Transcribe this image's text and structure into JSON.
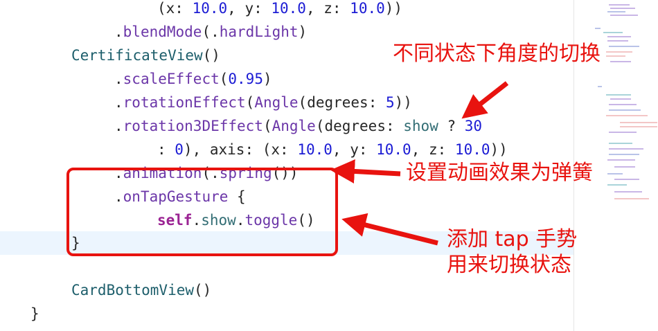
{
  "code": {
    "line1": [
      {
        "t": "(x: ",
        "c": "plain"
      },
      {
        "t": "10.0",
        "c": "num"
      },
      {
        "t": ", y: ",
        "c": "plain"
      },
      {
        "t": "10.0",
        "c": "num"
      },
      {
        "t": ", z: ",
        "c": "plain"
      },
      {
        "t": "10.0",
        "c": "num"
      },
      {
        "t": "))",
        "c": "plain"
      }
    ],
    "line2": [
      {
        "t": ".",
        "c": "plain"
      },
      {
        "t": "blendMode",
        "c": "method"
      },
      {
        "t": "(.",
        "c": "plain"
      },
      {
        "t": "hardLight",
        "c": "method"
      },
      {
        "t": ")",
        "c": "plain"
      }
    ],
    "line3": [
      {
        "t": "CertificateView",
        "c": "type"
      },
      {
        "t": "()",
        "c": "plain"
      }
    ],
    "line4": [
      {
        "t": ".",
        "c": "plain"
      },
      {
        "t": "scaleEffect",
        "c": "method"
      },
      {
        "t": "(",
        "c": "plain"
      },
      {
        "t": "0.95",
        "c": "num"
      },
      {
        "t": ")",
        "c": "plain"
      }
    ],
    "line5": [
      {
        "t": ".",
        "c": "plain"
      },
      {
        "t": "rotationEffect",
        "c": "method"
      },
      {
        "t": "(",
        "c": "plain"
      },
      {
        "t": "Angle",
        "c": "method"
      },
      {
        "t": "(degrees: ",
        "c": "plain"
      },
      {
        "t": "5",
        "c": "num"
      },
      {
        "t": "))",
        "c": "plain"
      }
    ],
    "line6": [
      {
        "t": ".",
        "c": "plain"
      },
      {
        "t": "rotation3DEffect",
        "c": "method"
      },
      {
        "t": "(",
        "c": "plain"
      },
      {
        "t": "Angle",
        "c": "method"
      },
      {
        "t": "(degrees: ",
        "c": "plain"
      },
      {
        "t": "show",
        "c": "prop"
      },
      {
        "t": " ? ",
        "c": "plain"
      },
      {
        "t": "30",
        "c": "num"
      }
    ],
    "line7": [
      {
        "t": ": ",
        "c": "plain"
      },
      {
        "t": "0",
        "c": "num"
      },
      {
        "t": "), axis: (x: ",
        "c": "plain"
      },
      {
        "t": "10.0",
        "c": "num"
      },
      {
        "t": ", y: ",
        "c": "plain"
      },
      {
        "t": "10.0",
        "c": "num"
      },
      {
        "t": ", z: ",
        "c": "plain"
      },
      {
        "t": "10.0",
        "c": "num"
      },
      {
        "t": "))",
        "c": "plain"
      }
    ],
    "line8": [
      {
        "t": ".",
        "c": "plain"
      },
      {
        "t": "animation",
        "c": "method"
      },
      {
        "t": "(.",
        "c": "plain"
      },
      {
        "t": "spring",
        "c": "method"
      },
      {
        "t": "())",
        "c": "plain"
      }
    ],
    "line9": [
      {
        "t": ".",
        "c": "plain"
      },
      {
        "t": "onTapGesture",
        "c": "method"
      },
      {
        "t": " {",
        "c": "plain"
      }
    ],
    "line10": [
      {
        "t": "self",
        "c": "kw"
      },
      {
        "t": ".",
        "c": "plain"
      },
      {
        "t": "show",
        "c": "prop"
      },
      {
        "t": ".",
        "c": "plain"
      },
      {
        "t": "toggle",
        "c": "method"
      },
      {
        "t": "()",
        "c": "plain"
      }
    ],
    "line11": [
      {
        "t": "}",
        "c": "plain"
      }
    ],
    "line12": [
      {
        "t": "CardBottomView",
        "c": "type"
      },
      {
        "t": "()",
        "c": "plain"
      }
    ],
    "line13": [
      {
        "t": "}",
        "c": "plain"
      }
    ]
  },
  "annotations": {
    "angle_toggle": "不同状态下角度的切换",
    "spring_animation": "设置动画效果为弹簧",
    "tap_gesture_line1": "添加 tap 手势",
    "tap_gesture_line2": "用来切换状态"
  },
  "colors": {
    "annotation_red": "#e8130f",
    "current_line_highlight": "#ecf5fe"
  }
}
